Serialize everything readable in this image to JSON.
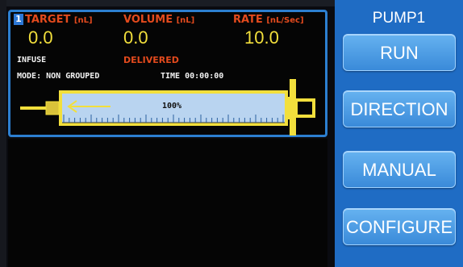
{
  "status": {
    "pump_number": "1",
    "target_header": "TARGET",
    "target_unit": "[nL]",
    "volume_header": "VOLUME",
    "volume_unit": "[nL]",
    "rate_header": "RATE",
    "rate_unit": "[nL/Sec]",
    "target_value": "0.0",
    "volume_value": "0.0",
    "rate_value": "10.0",
    "direction_text": "INFUSE",
    "volume_state": "DELIVERED",
    "mode_text": "MODE: NON GROUPED",
    "time_text": "TIME 00:00:00",
    "syringe_fill_label": "100%",
    "syringe_fill_fraction": 1.0
  },
  "side_panel": {
    "title": "PUMP1",
    "run_label": "RUN",
    "direction_label": "DIRECTION",
    "manual_label": "MANUAL",
    "configure_label": "CONFIGURE"
  },
  "colors": {
    "header_red": "#e34a1d",
    "value_yellow": "#f2df3c",
    "panel_border_blue": "#2c7fd0",
    "button_blue": "#4a9be6",
    "side_bg_blue": "#1f6cc4"
  },
  "icons": [
    "syringe-icon",
    "direction-arrow-icon"
  ]
}
